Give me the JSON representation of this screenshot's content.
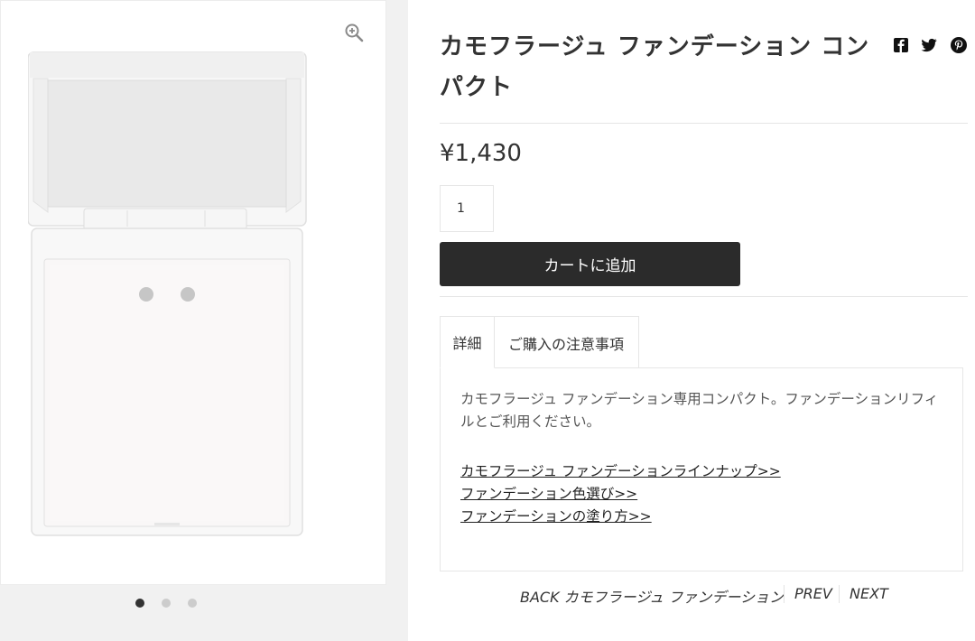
{
  "product": {
    "title": "カモフラージュ ファンデーション コンパクト",
    "price": "¥1,430",
    "quantity": "1",
    "add_to_cart_label": "カートに追加"
  },
  "gallery": {
    "slides": 3,
    "active_index": 0,
    "dot_active_color": "#333333",
    "dot_inactive_color": "#cccccc"
  },
  "share": {
    "icons": [
      "facebook-icon",
      "twitter-icon",
      "pinterest-icon"
    ]
  },
  "tabs": [
    {
      "label": "詳細",
      "active": true
    },
    {
      "label": "ご購入の注意事項",
      "active": false
    }
  ],
  "details": {
    "text": "カモフラージュ ファンデーション専用コンパクト。ファンデーションリフィルとご利用ください。",
    "links": [
      "カモフラージュ ファンデーションラインナップ>>",
      "ファンデーション色選び>>",
      "ファンデーションの塗り方>>"
    ]
  },
  "pager": {
    "back": "BACK カモフラージュ ファンデーション",
    "prev": "PREV",
    "next": "NEXT"
  },
  "colors": {
    "button_bg": "#2b2b2b",
    "page_bg": "#f1f1f1",
    "text": "#333333"
  }
}
